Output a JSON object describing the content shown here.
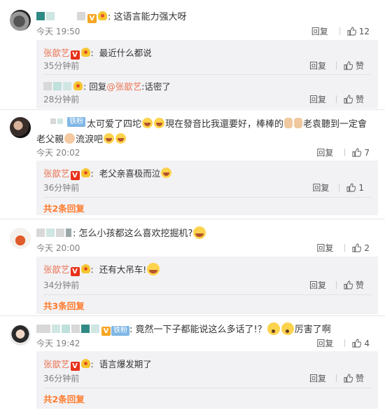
{
  "comments": [
    {
      "text": "这语言能力强大呀",
      "time": "今天 19:50",
      "reply_label": "回复",
      "likes": "12",
      "replies": [
        {
          "name": "张歆艺",
          "text": "最近什么都说",
          "time": "35分钟前",
          "reply_label": "回复",
          "likes": "赞"
        }
      ],
      "nested_reply": {
        "prefix": "回复",
        "mention": "@张歆艺",
        "text": ":话密了",
        "time": "28分钟前",
        "reply_label": "回复",
        "likes": "赞"
      }
    },
    {
      "badge": "铁粉",
      "text": "太可爱了四坨",
      "text2": "現在發音比我還要好，棒棒的",
      "text3": "老袁聽到一定會老父親",
      "text4": "流淚",
      "text5": "吧",
      "time": "今天 20:02",
      "reply_label": "回复",
      "likes": "7",
      "replies": [
        {
          "name": "张歆艺",
          "text": "老父亲喜极而泣",
          "time": "36分钟前",
          "reply_label": "回复",
          "likes": "1"
        }
      ],
      "more": "共2条回复"
    },
    {
      "text": "怎么小孩都这么喜欢挖掘机?",
      "time": "今天 20:00",
      "reply_label": "回复",
      "likes": "2",
      "replies": [
        {
          "name": "张歆艺",
          "text": "还有大吊车!",
          "time": "34分钟前",
          "reply_label": "回复",
          "likes": "赞"
        }
      ],
      "more": "共3条回复"
    },
    {
      "badge": "铁粉",
      "text": "竟然一下子都能说这么多话了!？",
      "text2": "厉害了啊",
      "time": "今天 19:42",
      "reply_label": "回复",
      "likes": "4",
      "replies": [
        {
          "name": "张歆艺",
          "text": "语言爆发期了",
          "time": "36分钟前",
          "reply_label": "回复",
          "likes": "赞"
        }
      ],
      "more": "共2条回复"
    }
  ],
  "icons": {
    "thumb": "thumbs-up-icon",
    "verified": "v-badge-icon",
    "crown": "vip-crown-icon"
  },
  "colors": {
    "username": "#eb7350",
    "more_link": "#ff7b2c",
    "subbox_bg": "#f2f2f5"
  }
}
